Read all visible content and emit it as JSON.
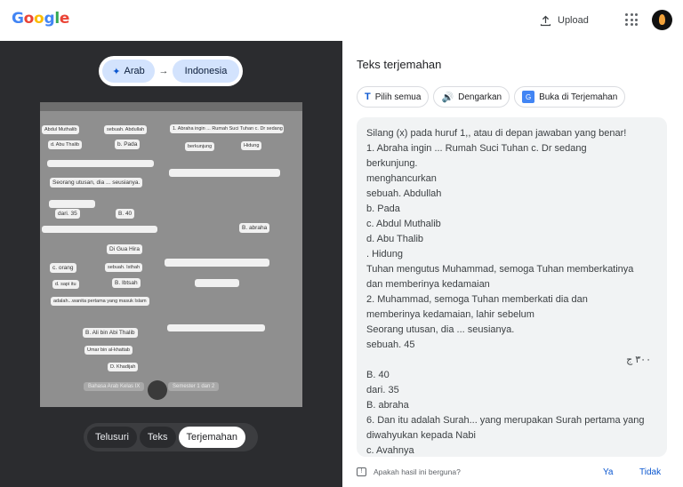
{
  "header": {
    "logo_text": "Google",
    "upload_label": "Upload",
    "apps_icon": "apps-grid-icon",
    "avatar_icon": "account-avatar"
  },
  "left_panel": {
    "source_language": "Arab",
    "target_language": "Indonesia",
    "arrow": "→",
    "sparkle": "✦",
    "modes": [
      "Telusuri",
      "Teks",
      "Terjemahan"
    ],
    "active_mode": "Terjemahan",
    "document_chips": [
      "Abdul Muthalib",
      "sebuah. Abdullah",
      "1. Abraha ingin ... Rumah Suci Tuhan c. Dr sedang",
      "d. Abu Thalib",
      "b. Pada",
      "berkunjung",
      "Hidung",
      "Seorang utusan, dia ... seusianya.",
      "dari. 35",
      "B. 40",
      "B. abraha",
      "Di Gua Hira",
      "c. orang",
      "sebuah. Isthah",
      "B. Ibtsah",
      "d. sapi itu",
      "adalah...wanita pertama yang masuk Islam",
      "B. Ali bin Abi Thalib",
      "Umar bin al-khattab",
      "D. Khadijah",
      "Bahasa Arab Kelas IX",
      "Semester 1 dan 2"
    ]
  },
  "right_panel": {
    "title": "Teks terjemahan",
    "buttons": {
      "select_all": "Pilih semua",
      "listen": "Dengarkan",
      "open_translate": "Buka di Terjemahan"
    },
    "translated_lines": [
      "Silang (x) pada huruf 1,, atau di depan jawaban yang benar!",
      "1. Abraha ingin ... Rumah Suci Tuhan c. Dr sedang",
      "berkunjung.",
      "menghancurkan",
      "sebuah. Abdullah",
      "b. Pada",
      "c. Abdul Muthalib",
      "d. Abu Thalib",
      ". Hidung",
      "Tuhan mengutus Muhammad, semoga Tuhan memberkatinya",
      "dan memberinya kedamaian",
      "2. Muhammad, semoga Tuhan memberkati dia dan",
      "memberinya kedamaian, lahir sebelum",
      "Seorang utusan, dia ... seusianya.",
      "sebuah. 45",
      "٣٠٠ ج",
      "B. 40",
      "dari. 35",
      "B. abraha",
      "6. Dan itu adalah Surah... yang merupakan Surah pertama yang",
      "diwahyukan kepada Nabi",
      "c. Avahnya"
    ],
    "feedback": {
      "question": "Apakah hasil ini berguna?",
      "yes": "Ya",
      "no": "Tidak"
    }
  }
}
